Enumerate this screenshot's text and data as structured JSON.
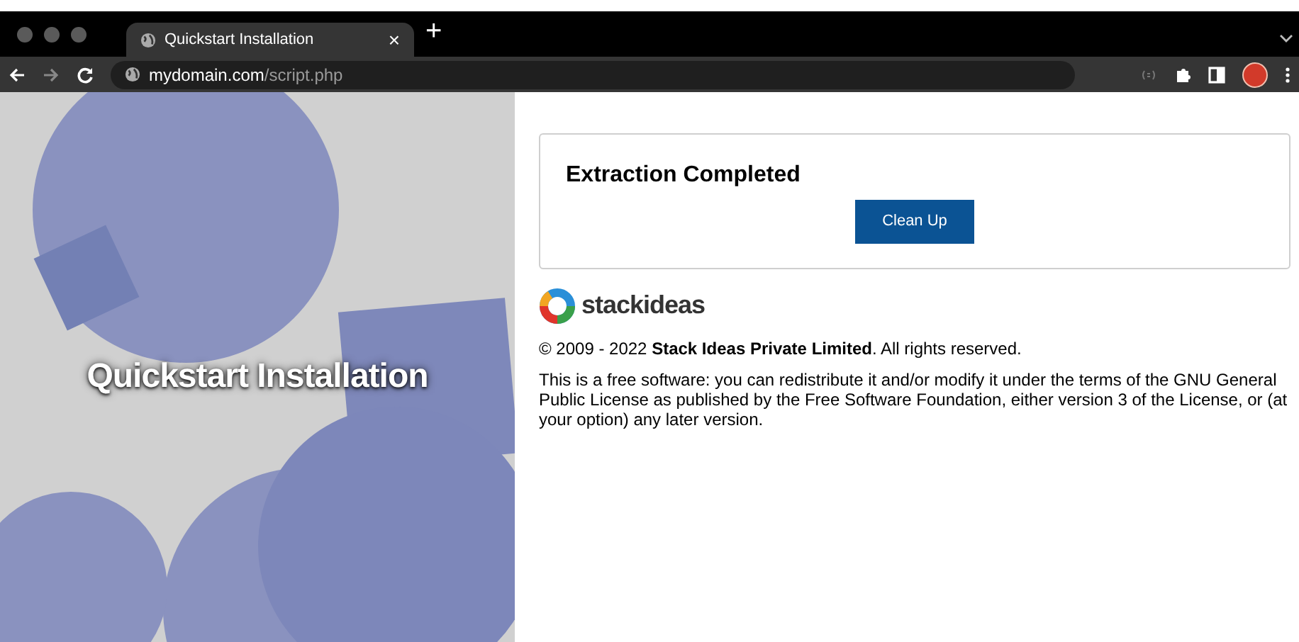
{
  "browser": {
    "tabs": [
      {
        "title": "Quickstart Installation",
        "close": "×",
        "selected": true
      }
    ],
    "new_tab": "+",
    "address": {
      "host": "mydomain.com",
      "path": "/script.php"
    }
  },
  "hero": {
    "title": "Quickstart Installation"
  },
  "card": {
    "heading": "Extraction Completed",
    "button": "Clean Up"
  },
  "brand": {
    "logo_text": "stackideas"
  },
  "copyright": "© 2009 - 2022 **Stack Ideas Private Limited**. All rights reserved.",
  "license": "This is a free software: you can redistribute it and/or modify it under the terms of the GNU General Public License as published by the Free Software Foundation, either version 3 of the License, or (at your option) any later version."
}
